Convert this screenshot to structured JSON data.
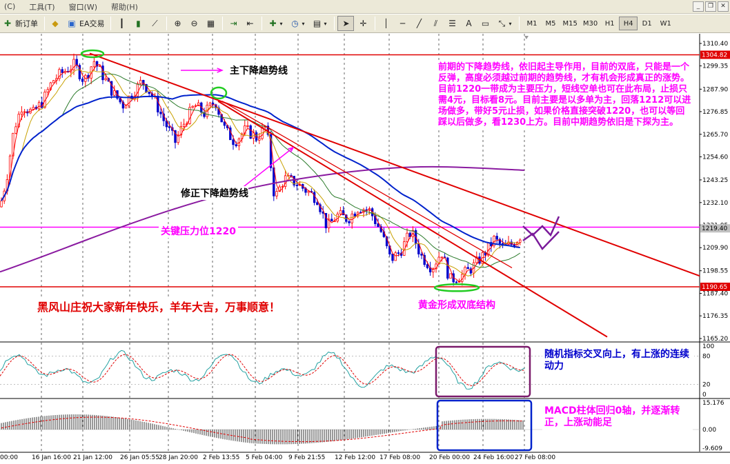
{
  "menu": {
    "items": [
      "工具(T)",
      "窗口(W)",
      "帮助(H)"
    ],
    "left_stub": "(C)"
  },
  "toolbar": {
    "new_order": "新订单",
    "ea": "EA交易",
    "timeframes": [
      "M1",
      "M5",
      "M15",
      "M30",
      "H1",
      "H4",
      "D1",
      "W1"
    ],
    "active_timeframe": "H4"
  },
  "price_axis": {
    "ticks": [
      "1310.40",
      "1299.35",
      "1287.90",
      "1276.85",
      "1265.70",
      "1254.60",
      "1243.25",
      "1232.10",
      "1221.05",
      "1209.90",
      "1198.55",
      "1187.40",
      "1176.35",
      "1165.20"
    ],
    "current_price": "1219.40",
    "resistance_label": "1304.82",
    "support_label": "1190.65",
    "stoch_ticks": [
      "100",
      "80",
      "20",
      "0"
    ],
    "macd_ticks": [
      "15.176",
      "0.00",
      "-9.609"
    ]
  },
  "time_axis": {
    "labels": [
      "00:00",
      "16 Jan 16:00",
      "21 Jan 12:00",
      "26 Jan 05:55",
      "28 Jan 20:00",
      "2 Feb 13:55",
      "5 Feb 04:00",
      "9 Feb 21:55",
      "12 Feb 12:00",
      "17 Feb 08:00",
      "20 Feb 00:00",
      "24 Feb 16:00",
      "27 Feb 08:00"
    ]
  },
  "annotations": {
    "main_trend": "主下降趋势线",
    "revised_trend": "修正下降趋势线",
    "key_resistance": "关键压力位1220",
    "greeting": "黑风山庄祝大家新年快乐，羊年大吉，万事顺意！",
    "double_bottom": "黄金形成双底结构",
    "analysis": "前期的下降趋势线，依旧起主导作用，目前的双底，只能是一个反弹，高度必须越过前期的趋势线，才有机会形成真正的涨势。目前1220一带成为主要压力，短线空单也可在此布局，止损只需4元，目标看8元。目前主要是以多单为主，回落1212可以进场做多，带好5元止损，如果价格直接突破1220，也可以等回踩以后做多，看1230上方。目前中期趋势依旧是下探为主。",
    "stoch_note": "随机指标交叉向上，有上涨的连续动力",
    "macd_note": "MACD柱体回归0轴，并逐渐转正，上涨动能足"
  },
  "colors": {
    "bull": "#ff0000",
    "bear": "#0000cc",
    "trendline": "#e00000",
    "key_level": "#ff00ff",
    "ma_blue": "#0022cc",
    "ma_purple": "#8a1aa0",
    "annotation_text_magenta": "#ff00ff",
    "annotation_text_red": "#e00000",
    "annotation_text_blue": "#0000cc"
  }
}
